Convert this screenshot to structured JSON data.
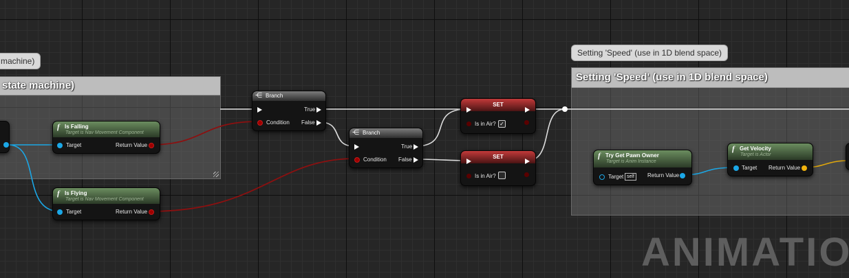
{
  "comments": {
    "left": {
      "bubble": "machine)",
      "title": "state machine)"
    },
    "right": {
      "bubble": "Setting 'Speed' (use in 1D blend space)",
      "title": "Setting 'Speed' (use in 1D blend space)"
    }
  },
  "nodes": {
    "is_falling": {
      "title": "Is Falling",
      "subtitle": "Target is Nav Movement Component",
      "target_label": "Target",
      "return_label": "Return Value"
    },
    "is_flying": {
      "title": "Is Flying",
      "subtitle": "Target is Nav Movement Component",
      "target_label": "Target",
      "return_label": "Return Value"
    },
    "branch1": {
      "title": "Branch",
      "true_label": "True",
      "false_label": "False",
      "condition_label": "Condition"
    },
    "branch2": {
      "title": "Branch",
      "true_label": "True",
      "false_label": "False",
      "condition_label": "Condition"
    },
    "set_true": {
      "title": "SET",
      "var_label": "Is in Air?",
      "checked": true
    },
    "set_false": {
      "title": "SET",
      "var_label": "Is in Air?",
      "checked": false
    },
    "try_get_pawn": {
      "title": "Try Get Pawn Owner",
      "subtitle": "Target is Anim Instance",
      "target_label": "Target",
      "self_label": "self",
      "return_label": "Return Value"
    },
    "get_velocity": {
      "title": "Get Velocity",
      "subtitle": "Target is Actor",
      "target_label": "Target",
      "return_label": "Return Value"
    }
  },
  "watermark": "ANIMATION",
  "colors": {
    "exec": "#ffffff",
    "object": "#1ba7e6",
    "bool": "#9e0000",
    "vector": "#f0b20d",
    "function_header": "#4f6b45",
    "set_header": "#a52a2a"
  }
}
